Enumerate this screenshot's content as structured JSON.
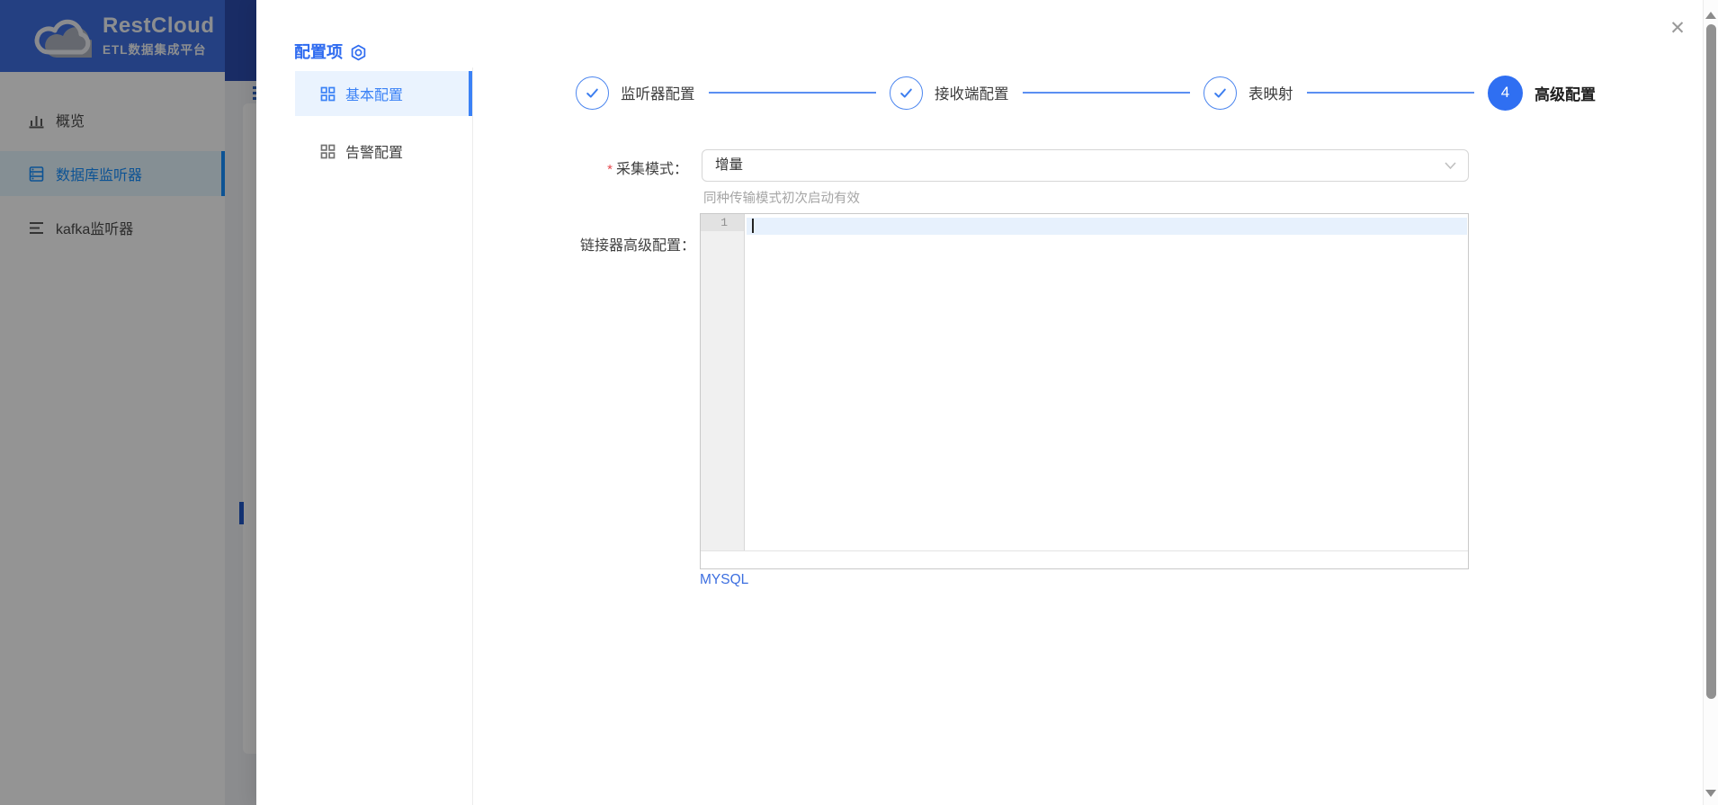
{
  "brand": {
    "name": "RestCloud",
    "subtitle": "ETL数据集成平台"
  },
  "sidebar": {
    "items": [
      {
        "label": "概览",
        "icon": "bar-chart-icon"
      },
      {
        "label": "数据库监听器",
        "icon": "database-icon",
        "selected": true
      },
      {
        "label": "kafka监听器",
        "icon": "queue-lines-icon"
      }
    ]
  },
  "drawer": {
    "title": "配置项",
    "title_icon": "aim-icon",
    "close_label": "✕",
    "nav": {
      "items": [
        {
          "label": "基本配置",
          "selected": true
        },
        {
          "label": "告警配置",
          "selected": false
        }
      ]
    },
    "steps": [
      {
        "label": "监听器配置",
        "status": "finished"
      },
      {
        "label": "接收端配置",
        "status": "finished"
      },
      {
        "label": "表映射",
        "status": "finished"
      },
      {
        "label": "高级配置",
        "status": "current",
        "number": "4"
      }
    ],
    "form": {
      "required_mark": "*",
      "collect_mode_label": "采集模式：",
      "collect_mode_value": "增量",
      "collect_mode_help": "同种传输模式初次启动有效",
      "advanced_label": "链接器高级配置：",
      "editor_line_number": "1",
      "footer_link": "MYSQL"
    }
  },
  "colors": {
    "brand_blue": "#3e6ee0",
    "accent_blue": "#2f6ff2",
    "menu_selected_blue": "#1890ff",
    "active_line_bg": "#e7f1fd",
    "mask": "rgba(0,0,0,0.42)"
  }
}
